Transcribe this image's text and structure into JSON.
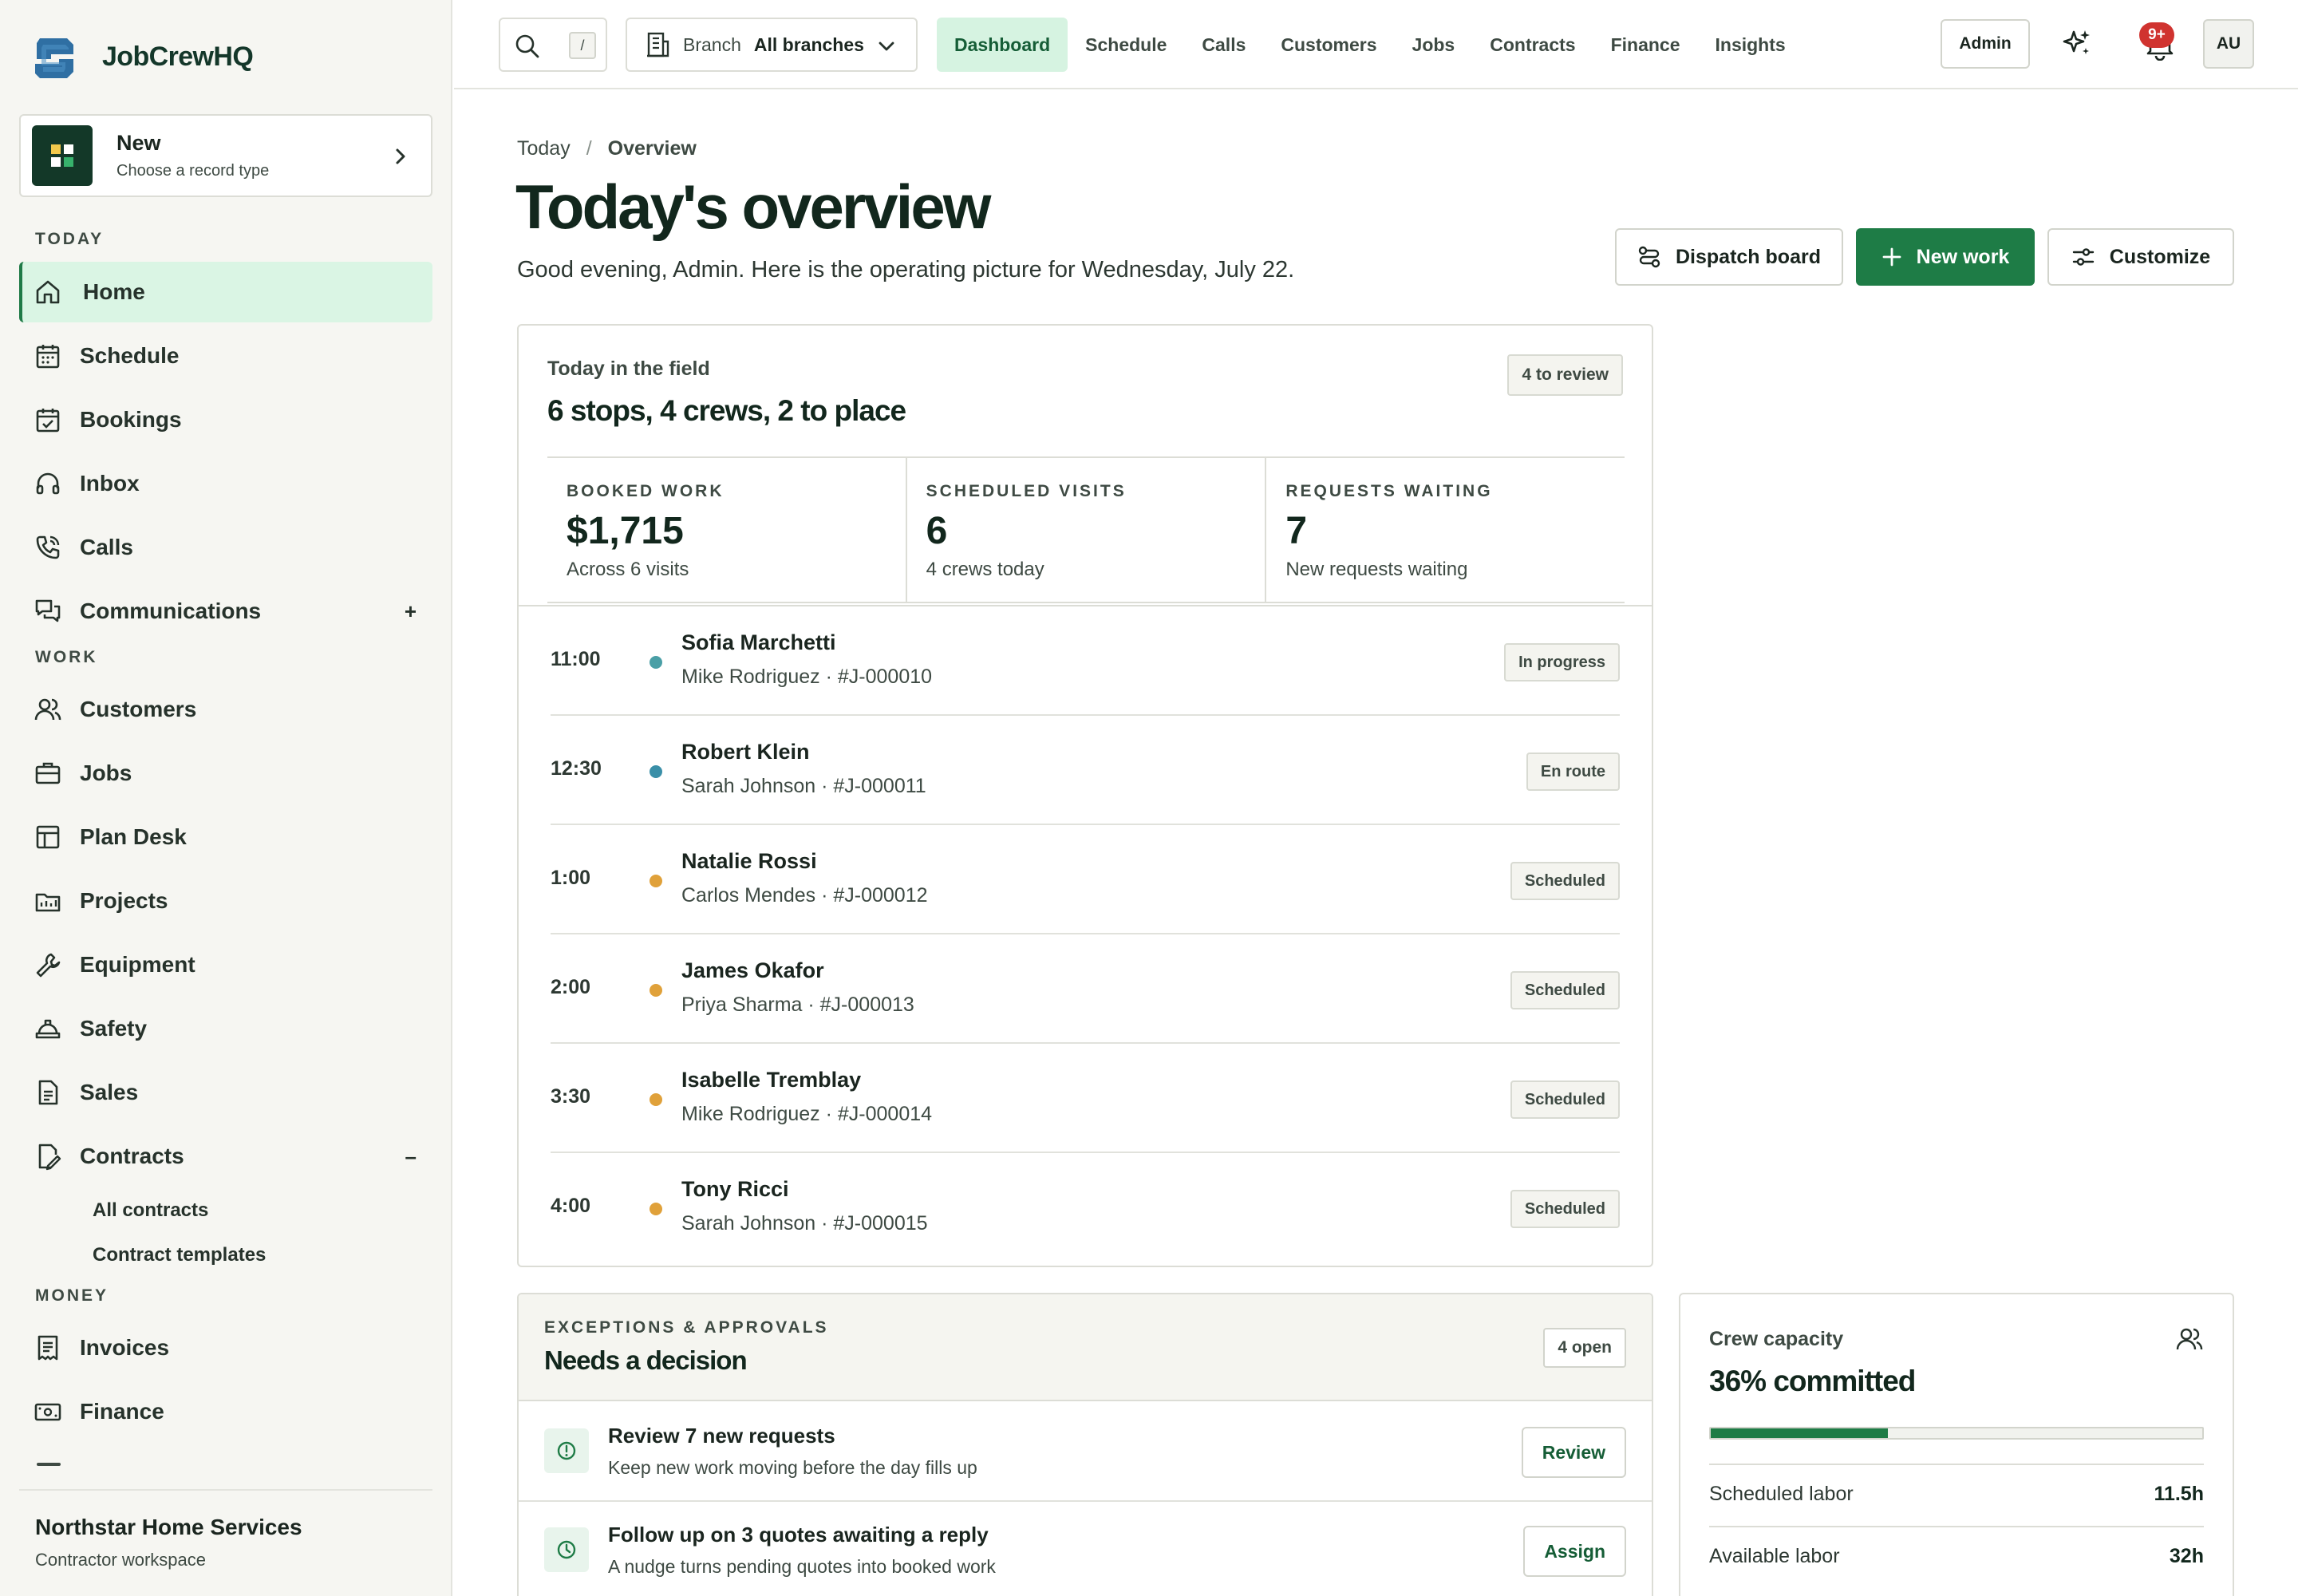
{
  "brand": {
    "name": "JobCrewHQ"
  },
  "new_card": {
    "title": "New",
    "subtitle": "Choose a record type"
  },
  "sidebar": {
    "sections": {
      "today": "TODAY",
      "work": "WORK",
      "money": "MONEY"
    },
    "today_items": [
      {
        "label": "Home",
        "icon": "home-icon",
        "active": true
      },
      {
        "label": "Schedule",
        "icon": "calendar-icon"
      },
      {
        "label": "Bookings",
        "icon": "calendar-check-icon"
      },
      {
        "label": "Inbox",
        "icon": "headset-icon"
      },
      {
        "label": "Calls",
        "icon": "phone-icon"
      },
      {
        "label": "Communications",
        "icon": "chat-icon",
        "expand": "+"
      }
    ],
    "work_items": [
      {
        "label": "Customers",
        "icon": "users-icon"
      },
      {
        "label": "Jobs",
        "icon": "briefcase-icon"
      },
      {
        "label": "Plan Desk",
        "icon": "layout-icon"
      },
      {
        "label": "Projects",
        "icon": "projects-icon"
      },
      {
        "label": "Equipment",
        "icon": "wrench-icon"
      },
      {
        "label": "Safety",
        "icon": "hardhat-icon"
      },
      {
        "label": "Sales",
        "icon": "document-icon"
      },
      {
        "label": "Contracts",
        "icon": "contract-icon",
        "expand": "–"
      }
    ],
    "contract_subitems": [
      "All contracts",
      "Contract templates"
    ],
    "money_items": [
      {
        "label": "Invoices",
        "icon": "invoice-icon"
      },
      {
        "label": "Finance",
        "icon": "cash-icon"
      }
    ],
    "org": {
      "name": "Northstar Home Services",
      "subtitle": "Contractor workspace"
    }
  },
  "topbar": {
    "search_shortcut": "/",
    "branch_label": "Branch",
    "branch_value": "All branches",
    "nav": [
      {
        "label": "Dashboard",
        "active": true
      },
      {
        "label": "Schedule"
      },
      {
        "label": "Calls"
      },
      {
        "label": "Customers"
      },
      {
        "label": "Jobs"
      },
      {
        "label": "Contracts"
      },
      {
        "label": "Finance"
      },
      {
        "label": "Insights"
      }
    ],
    "admin_label": "Admin",
    "notification_count": "9+",
    "avatar_initials": "AU"
  },
  "page": {
    "breadcrumb": [
      "Today",
      "Overview"
    ],
    "title": "Today's overview",
    "subtitle": "Good evening, Admin. Here is the operating picture for Wednesday, July 22.",
    "actions": {
      "dispatch": "Dispatch board",
      "new_work": "New work",
      "customize": "Customize"
    }
  },
  "field": {
    "kicker": "Today in the field",
    "title": "6 stops, 4 crews, 2 to place",
    "review_badge": "4 to review",
    "stats": [
      {
        "label": "BOOKED WORK",
        "value": "$1,715",
        "note": "Across 6 visits"
      },
      {
        "label": "SCHEDULED VISITS",
        "value": "6",
        "note": "4 crews today"
      },
      {
        "label": "REQUESTS WAITING",
        "value": "7",
        "note": "New requests waiting"
      }
    ],
    "visits": [
      {
        "time": "11:00",
        "customer": "Sofia Marchetti",
        "detail": "Mike Rodriguez · #J-000010",
        "status": "In progress",
        "dot": "#4a9fa6"
      },
      {
        "time": "12:30",
        "customer": "Robert Klein",
        "detail": "Sarah Johnson · #J-000011",
        "status": "En route",
        "dot": "#3a8fa8"
      },
      {
        "time": "1:00",
        "customer": "Natalie Rossi",
        "detail": "Carlos Mendes · #J-000012",
        "status": "Scheduled",
        "dot": "#e0a13a"
      },
      {
        "time": "2:00",
        "customer": "James Okafor",
        "detail": "Priya Sharma · #J-000013",
        "status": "Scheduled",
        "dot": "#e0a13a"
      },
      {
        "time": "3:30",
        "customer": "Isabelle Tremblay",
        "detail": "Mike Rodriguez · #J-000014",
        "status": "Scheduled",
        "dot": "#e0a13a"
      },
      {
        "time": "4:00",
        "customer": "Tony Ricci",
        "detail": "Sarah Johnson · #J-000015",
        "status": "Scheduled",
        "dot": "#e0a13a"
      }
    ]
  },
  "exceptions": {
    "kicker": "EXCEPTIONS & APPROVALS",
    "title": "Needs a decision",
    "badge": "4 open",
    "items": [
      {
        "title": "Review 7 new requests",
        "subtitle": "Keep new work moving before the day fills up",
        "action": "Review",
        "icon": "alert-circle-icon"
      },
      {
        "title": "Follow up on 3 quotes awaiting a reply",
        "subtitle": "A nudge turns pending quotes into booked work",
        "action": "Assign",
        "icon": "clock-icon"
      }
    ]
  },
  "capacity": {
    "kicker": "Crew capacity",
    "title": "36% committed",
    "committed_fraction": 0.36,
    "rows": [
      {
        "label": "Scheduled labor",
        "value": "11.5h"
      },
      {
        "label": "Available labor",
        "value": "32h"
      }
    ]
  },
  "colors": {
    "accent": "#1e7c46",
    "accent_soft": "#d6f3e1",
    "danger": "#d0332f"
  }
}
